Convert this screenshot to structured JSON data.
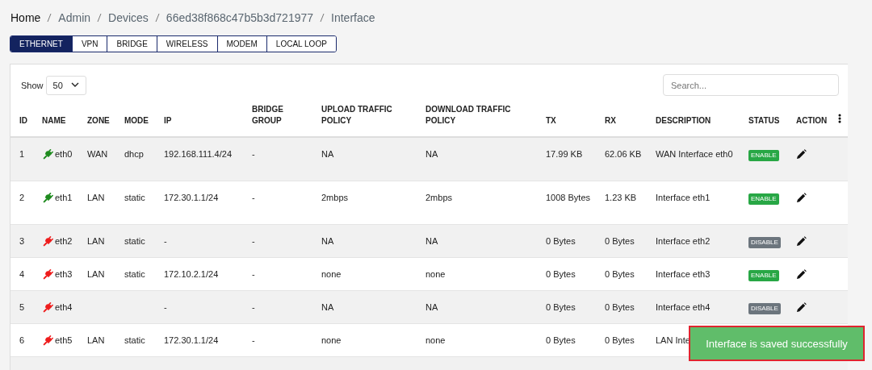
{
  "breadcrumb": [
    "Home",
    "Admin",
    "Devices",
    "66ed38f868c47b5b3d721977",
    "Interface"
  ],
  "tabs": [
    {
      "label": "ETHERNET",
      "selected": true
    },
    {
      "label": "VPN",
      "selected": false
    },
    {
      "label": "BRIDGE",
      "selected": false
    },
    {
      "label": "WIRELESS",
      "selected": false
    },
    {
      "label": "MODEM",
      "selected": false
    },
    {
      "label": "LOCAL LOOP",
      "selected": false
    }
  ],
  "show": {
    "label": "Show",
    "value": "50"
  },
  "search": {
    "placeholder": "Search..."
  },
  "table": {
    "columns": [
      "ID",
      "NAME",
      "ZONE",
      "MODE",
      "IP",
      "BRIDGE GROUP",
      "UPLOAD TRAFFIC POLICY",
      "DOWNLOAD TRAFFIC POLICY",
      "TX",
      "RX",
      "DESCRIPTION",
      "STATUS",
      "ACTION"
    ],
    "rows": [
      {
        "id": "1",
        "connected": true,
        "name": "eth0",
        "zone": "WAN",
        "mode": "dhcp",
        "ip": "192.168.111.4/24",
        "bridge_group": "-",
        "upload": "NA",
        "download": "NA",
        "tx": "17.99 KB",
        "rx": "62.06 KB",
        "description": "WAN Interface eth0",
        "status": {
          "label": "ENABLE",
          "enabled": true
        }
      },
      {
        "id": "2",
        "connected": true,
        "name": "eth1",
        "zone": "LAN",
        "mode": "static",
        "ip": "172.30.1.1/24",
        "bridge_group": "-",
        "upload": "2mbps",
        "download": "2mbps",
        "tx": "1008 Bytes",
        "rx": "1.23 KB",
        "description": "Interface eth1",
        "status": {
          "label": "ENABLE",
          "enabled": true
        }
      },
      {
        "id": "3",
        "connected": false,
        "name": "eth2",
        "zone": "LAN",
        "mode": "static",
        "ip": "-",
        "bridge_group": "-",
        "upload": "NA",
        "download": "NA",
        "tx": "0 Bytes",
        "rx": "0 Bytes",
        "description": "Interface eth2",
        "status": {
          "label": "DISABLE",
          "enabled": false
        }
      },
      {
        "id": "4",
        "connected": false,
        "name": "eth3",
        "zone": "LAN",
        "mode": "static",
        "ip": "172.10.2.1/24",
        "bridge_group": "-",
        "upload": "none",
        "download": "none",
        "tx": "0 Bytes",
        "rx": "0 Bytes",
        "description": "Interface eth3",
        "status": {
          "label": "ENABLE",
          "enabled": true
        }
      },
      {
        "id": "5",
        "connected": false,
        "name": "eth4",
        "ip": "-",
        "bridge_group": "-",
        "upload": "NA",
        "download": "NA",
        "tx": "0 Bytes",
        "rx": "0 Bytes",
        "description": "Interface eth4",
        "status": {
          "label": "DISABLE",
          "enabled": false
        }
      },
      {
        "id": "6",
        "connected": false,
        "name": "eth5",
        "zone": "LAN",
        "mode": "static",
        "ip": "172.30.1.1/24",
        "bridge_group": "-",
        "upload": "none",
        "download": "none",
        "tx": "0 Bytes",
        "rx": "0 Bytes",
        "description": "LAN Inte"
      }
    ]
  },
  "toast": {
    "message": "Interface is saved successfully"
  }
}
